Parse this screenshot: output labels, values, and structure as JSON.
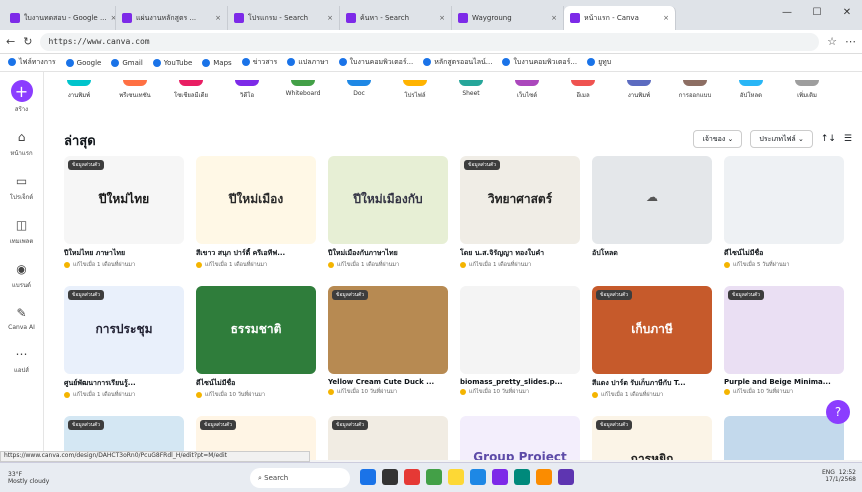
{
  "browser": {
    "tabs": [
      "ใบงานทดสอบ - Google ...",
      "แผ่นงานหลักสูตร ...",
      "โปรแกรม - Search",
      "ค้นหา - Search",
      "Waygroung",
      "หน้าแรก - Canva"
    ],
    "url": "https://www.canva.com",
    "bookmarks": [
      "ไฟล์ทางการ",
      "Google",
      "Gmail",
      "YouTube",
      "Maps",
      "ข่าวสาร",
      "แปลภาษา",
      "ใบงานคอมพิวเตอร์...",
      "หลักสูตรออนไลน์...",
      "ใบงานคอมพิวเตอร์...",
      "ยูทูบ"
    ],
    "status_url": "https://www.canva.com/design/DAHCT3oRn0/PcuG8FRdl_H/edit?pt=M/edit"
  },
  "rail": [
    {
      "label": "สร้าง"
    },
    {
      "label": "หน้าแรก"
    },
    {
      "label": "โปรเจ็กต์"
    },
    {
      "label": "เทมเพลต"
    },
    {
      "label": "แบรนด์"
    },
    {
      "label": "Canva AI"
    },
    {
      "label": "แอปส์"
    }
  ],
  "quick": [
    "งานพิมพ์",
    "พรีเซนเทชัน",
    "โซเชียลมีเดีย",
    "วิดีโอ",
    "Whiteboard",
    "Doc",
    "โปรไฟล์",
    "Sheet",
    "เว็บไซต์",
    "อีเมล",
    "งานพิมพ์",
    "การออกแบบ",
    "อัปโหลด",
    "เพิ่มเติม"
  ],
  "heading": "ล่าสุด",
  "sort": {
    "owner": "เจ้าของ",
    "type": "ประเภทไฟล์",
    "sort_icon": "↑↓"
  },
  "cards": [
    {
      "title": "ปีใหม่ไทย ภาษาไทย",
      "meta": "แก้ไขเมื่อ 1 เดือนที่ผ่านมา",
      "tag": "ข้อมูลส่วนตัว",
      "thumb": "ปีใหม่ไทย",
      "bg": "#f6f6f6",
      "fg": "#1a1a1a"
    },
    {
      "title": "สีเขาว สนุก ปาร์ตี้ ครีเอทีฟ...",
      "meta": "แก้ไขเมื่อ 1 เดือนที่ผ่านมา",
      "tag": "",
      "thumb": "ปีใหม่เมือง",
      "bg": "#fff8e6",
      "fg": "#2a2a2a"
    },
    {
      "title": "ปีใหม่เมืองกับภาษาไทย",
      "meta": "แก้ไขเมื่อ 1 เดือนที่ผ่านมา",
      "tag": "",
      "thumb": "ปีใหม่เมืองกับ",
      "bg": "#e7efd5",
      "fg": "#334"
    },
    {
      "title": "โดย น.ส.จิรัญญา ทองใบคำ",
      "meta": "แก้ไขเมื่อ 1 เดือนที่ผ่านมา",
      "tag": "ข้อมูลส่วนตัว",
      "thumb": "วิทยาศาสตร์",
      "bg": "#f0ede6",
      "fg": "#222"
    },
    {
      "title": "อัปโหลด",
      "meta": "",
      "tag": "",
      "thumb": "☁",
      "bg": "#e4e7ea",
      "fg": "#555"
    },
    {
      "title": "ดีไซน์ไม่มีชื่อ",
      "meta": "แก้ไขเมื่อ 5 วันที่ผ่านมา",
      "tag": "",
      "thumb": "",
      "bg": "#eef1f4",
      "fg": "#222"
    },
    {
      "title": "ศูนย์พัฒนาการเรียนรู้...",
      "meta": "แก้ไขเมื่อ 1 เดือนที่ผ่านมา",
      "tag": "ข้อมูลส่วนตัว",
      "thumb": "การประชุม",
      "bg": "#e9f0fb",
      "fg": "#223"
    },
    {
      "title": "ดีไซน์ไม่มีชื่อ",
      "meta": "แก้ไขเมื่อ 10 วันที่ผ่านมา",
      "tag": "",
      "thumb": "ธรรมชาติ",
      "bg": "#2f7d3b",
      "fg": "#fff"
    },
    {
      "title": "Yellow Cream Cute Duck ...",
      "meta": "แก้ไขเมื่อ 10 วันที่ผ่านมา",
      "tag": "ข้อมูลส่วนตัว",
      "thumb": "",
      "bg": "#b78a52",
      "fg": "#fff"
    },
    {
      "title": "biomass_pretty_slides.p...",
      "meta": "แก้ไขเมื่อ 10 วันที่ผ่านมา",
      "tag": "",
      "thumb": "",
      "bg": "#f4f4f4",
      "fg": "#222"
    },
    {
      "title": "สีแดง ปาร์ต รับเก็บภาษีกับ T...",
      "meta": "แก้ไขเมื่อ 1 เดือนที่ผ่านมา",
      "tag": "ข้อมูลส่วนตัว",
      "thumb": "เก็บภาษี",
      "bg": "#c65a2b",
      "fg": "#fff"
    },
    {
      "title": "Purple and Beige Minima...",
      "meta": "แก้ไขเมื่อ 10 วันที่ผ่านมา",
      "tag": "ข้อมูลส่วนตัว",
      "thumb": "",
      "bg": "#eadff3",
      "fg": "#333"
    },
    {
      "title": "",
      "meta": "",
      "tag": "ข้อมูลส่วนตัว",
      "thumb": "",
      "bg": "#d4e7f3",
      "fg": "#222"
    },
    {
      "title": "",
      "meta": "",
      "tag": "ข้อมูลส่วนตัว",
      "thumb": "",
      "bg": "#fff5e5",
      "fg": "#222"
    },
    {
      "title": "",
      "meta": "",
      "tag": "ข้อมูลส่วนตัว",
      "thumb": "",
      "bg": "#f1ece3",
      "fg": "#222"
    },
    {
      "title": "",
      "meta": "",
      "tag": "",
      "thumb": "Group Project",
      "bg": "#f3eefc",
      "fg": "#5d4ba8"
    },
    {
      "title": "",
      "meta": "",
      "tag": "ข้อมูลส่วนตัว",
      "thumb": "การหยิก",
      "bg": "#fbf4e7",
      "fg": "#222"
    },
    {
      "title": "",
      "meta": "",
      "tag": "",
      "thumb": "",
      "bg": "#c3d9ec",
      "fg": "#222"
    }
  ],
  "taskbar": {
    "weather": "33°F",
    "weather2": "Mostly cloudy",
    "search": "Search",
    "time": "12:52",
    "date": "17/1/2568",
    "lang": "ENG"
  }
}
